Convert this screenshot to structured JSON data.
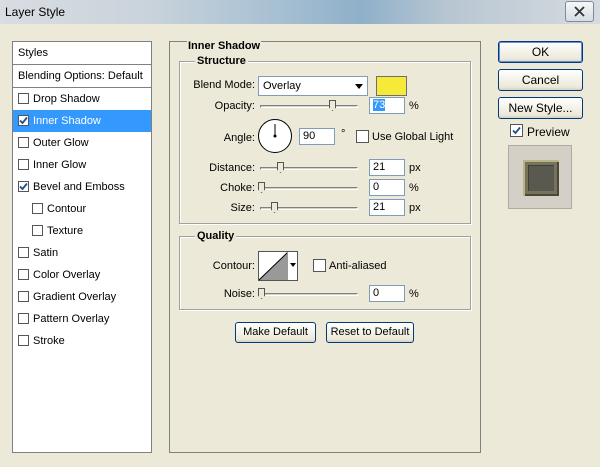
{
  "window": {
    "title": "Layer Style"
  },
  "styles_panel": {
    "header": "Styles",
    "blending_options": "Blending Options: Default",
    "items": [
      {
        "label": "Drop Shadow",
        "checked": false,
        "sub": false,
        "selected": false
      },
      {
        "label": "Inner Shadow",
        "checked": true,
        "sub": false,
        "selected": true
      },
      {
        "label": "Outer Glow",
        "checked": false,
        "sub": false,
        "selected": false
      },
      {
        "label": "Inner Glow",
        "checked": false,
        "sub": false,
        "selected": false
      },
      {
        "label": "Bevel and Emboss",
        "checked": true,
        "sub": false,
        "selected": false
      },
      {
        "label": "Contour",
        "checked": false,
        "sub": true,
        "selected": false
      },
      {
        "label": "Texture",
        "checked": false,
        "sub": true,
        "selected": false
      },
      {
        "label": "Satin",
        "checked": false,
        "sub": false,
        "selected": false
      },
      {
        "label": "Color Overlay",
        "checked": false,
        "sub": false,
        "selected": false
      },
      {
        "label": "Gradient Overlay",
        "checked": false,
        "sub": false,
        "selected": false
      },
      {
        "label": "Pattern Overlay",
        "checked": false,
        "sub": false,
        "selected": false
      },
      {
        "label": "Stroke",
        "checked": false,
        "sub": false,
        "selected": false
      }
    ]
  },
  "inner_shadow": {
    "title": "Inner Shadow",
    "structure": {
      "title": "Structure",
      "blend_mode_label": "Blend Mode:",
      "blend_mode": "Overlay",
      "color": "#f6ea38",
      "opacity_label": "Opacity:",
      "opacity": "73",
      "opacity_unit": "%",
      "angle_label": "Angle:",
      "angle": "90",
      "angle_unit": "°",
      "use_global_light": "Use Global Light",
      "use_global_light_checked": false,
      "distance_label": "Distance:",
      "distance": "21",
      "distance_unit": "px",
      "choke_label": "Choke:",
      "choke": "0",
      "choke_unit": "%",
      "size_label": "Size:",
      "size": "21",
      "size_unit": "px"
    },
    "quality": {
      "title": "Quality",
      "contour_label": "Contour:",
      "anti_aliased": "Anti-aliased",
      "anti_aliased_checked": false,
      "noise_label": "Noise:",
      "noise": "0",
      "noise_unit": "%"
    },
    "make_default": "Make Default",
    "reset_to_default": "Reset to Default"
  },
  "actions": {
    "ok": "OK",
    "cancel": "Cancel",
    "new_style": "New Style...",
    "preview": "Preview",
    "preview_checked": true
  }
}
